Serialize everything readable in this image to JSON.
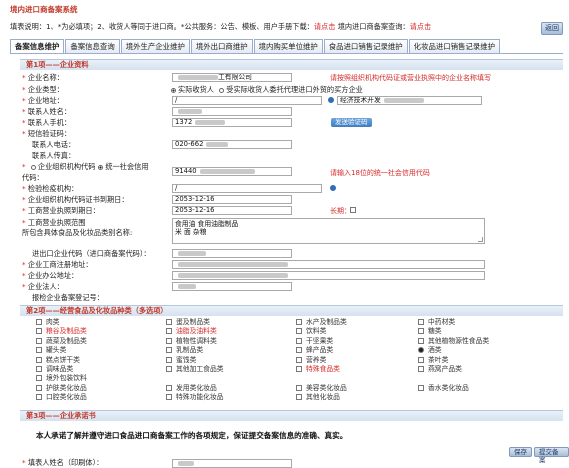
{
  "system_title": "境内进口商备案系统",
  "notice": {
    "prefix": "填表说明：1、*为必填项；2、收货人等同于进口商。*公共服务：公告、模板、用户手册下载：",
    "link1": "请点击",
    "middle": "  境内进口商备案查询：",
    "link2": "请点击"
  },
  "return_button": "返回",
  "tabs": [
    {
      "label": "备案信息维护"
    },
    {
      "label": "备案信息查询"
    },
    {
      "label": "境外生产企业维护"
    },
    {
      "label": "境外出口商维护"
    },
    {
      "label": "境内购买单位维护"
    },
    {
      "label": "食品进口销售记录维护"
    },
    {
      "label": "化妆品进口销售记录维护"
    }
  ],
  "section1": {
    "title": "第1项——企业资料",
    "fields": {
      "company_name_label": "企业名称：",
      "company_name_value": "工有限公司",
      "company_name_hint": "请按照组织机构代码证或营业执照中的企业名称填写",
      "company_type_label": "企业类型：",
      "company_type_opt1": "实际收货人",
      "company_type_opt2": "受实际收货人委托代理进口外贸的买方企业",
      "address_label": "企业地址：",
      "address_value": "/",
      "address_right_value": "经济技术开发",
      "contact_label": "联系人姓名：",
      "contact_value": "",
      "mobile_label": "联系人手机：",
      "mobile_value": "1372",
      "verify_button": "发送验证码",
      "sms_label": "短信验证码：",
      "phone_label": "联系人电话：",
      "phone_value": "020-662",
      "fax_label": "联系人传真：",
      "code_label_opt1": "企业组织机构代码",
      "code_label_opt2": "统一社会信用",
      "code_label_tail": "代码：",
      "code_value": "91440",
      "code_hint": "请输入18位的统一社会信用代码",
      "inspection_label": "检验检疫机构：",
      "inspection_value": "/",
      "org_expiry_label": "企业组织机构代码证书到期日：",
      "org_expiry_value": "2053-12-16",
      "license_expiry_label": "工商营业执照到期日：",
      "license_expiry_value": "2053-12-16",
      "long_term_label": "长期：",
      "scope_label": "工商营业执照范围",
      "scope_label2": "所包含具体食品及化妆品类别名称:",
      "scope_value_line1": "食用油 食用油脂制品",
      "scope_value_line2": "米 面 杂粮",
      "import_code_label": "进出口企业代码（进口商备案代码）：",
      "reg_address_label": "企业工商注册地址：",
      "office_address_label": "企业办公地址：",
      "legal_rep_label": "企业法人：",
      "legal_rep_value": "",
      "record_no_label": "报检企业备案登记号："
    }
  },
  "section2": {
    "title": "第2项——经营食品及化妆品种类（多选项）",
    "items": [
      {
        "label": "肉类",
        "color": "plain"
      },
      {
        "label": "蛋及制品类",
        "color": "plain"
      },
      {
        "label": "水产及制品类",
        "color": "plain"
      },
      {
        "label": "中药材类",
        "color": "plain"
      },
      {
        "label": "粮谷及制品类",
        "color": "red"
      },
      {
        "label": "油脂及油料类",
        "color": "red"
      },
      {
        "label": "饮料类",
        "color": "plain"
      },
      {
        "label": "糖类",
        "color": "plain"
      },
      {
        "label": "蔬菜及制品类",
        "color": "plain"
      },
      {
        "label": "植物性调料类",
        "color": "plain"
      },
      {
        "label": "干坚果类",
        "color": "plain"
      },
      {
        "label": "其他植物源性食品类",
        "color": "plain"
      },
      {
        "label": "罐头类",
        "color": "plain"
      },
      {
        "label": "乳制品类",
        "color": "plain"
      },
      {
        "label": "蜂产品类",
        "color": "plain"
      },
      {
        "label": "酒类",
        "color": "plain"
      },
      {
        "label": "糕点饼干类",
        "color": "plain"
      },
      {
        "label": "蜜饯类",
        "color": "plain"
      },
      {
        "label": "营养类",
        "color": "plain"
      },
      {
        "label": "茶叶类",
        "color": "plain"
      },
      {
        "label": "调味品类",
        "color": "plain"
      },
      {
        "label": "其他加工食品类",
        "color": "plain"
      },
      {
        "label": "特殊食品类",
        "color": "red"
      },
      {
        "label": "燕窝产品类",
        "color": "plain"
      },
      {
        "label": "境外包装饮料",
        "color": "plain"
      },
      {
        "label": "",
        "color": "plain"
      },
      {
        "label": "",
        "color": "plain"
      },
      {
        "label": "",
        "color": "plain"
      },
      {
        "label": "护肤类化妆品",
        "color": "plain"
      },
      {
        "label": "发用类化妆品",
        "color": "plain"
      },
      {
        "label": "美容类化妆品",
        "color": "plain"
      },
      {
        "label": "香水类化妆品",
        "color": "plain"
      },
      {
        "label": "口腔类化妆品",
        "color": "plain"
      },
      {
        "label": "特殊功能化妆品",
        "color": "plain"
      },
      {
        "label": "其他化妆品",
        "color": "plain"
      }
    ]
  },
  "section3": {
    "title": "第3项——企业承诺书",
    "pledge": "本人承诺了解并遵守进口食品进口商备案工作的各项规定，保证提交备案信息的准确、真实。"
  },
  "bottom": {
    "signer_label": "填表人姓名（印刷体）：",
    "btn_save": "保存",
    "btn_submit": "提交备案"
  }
}
